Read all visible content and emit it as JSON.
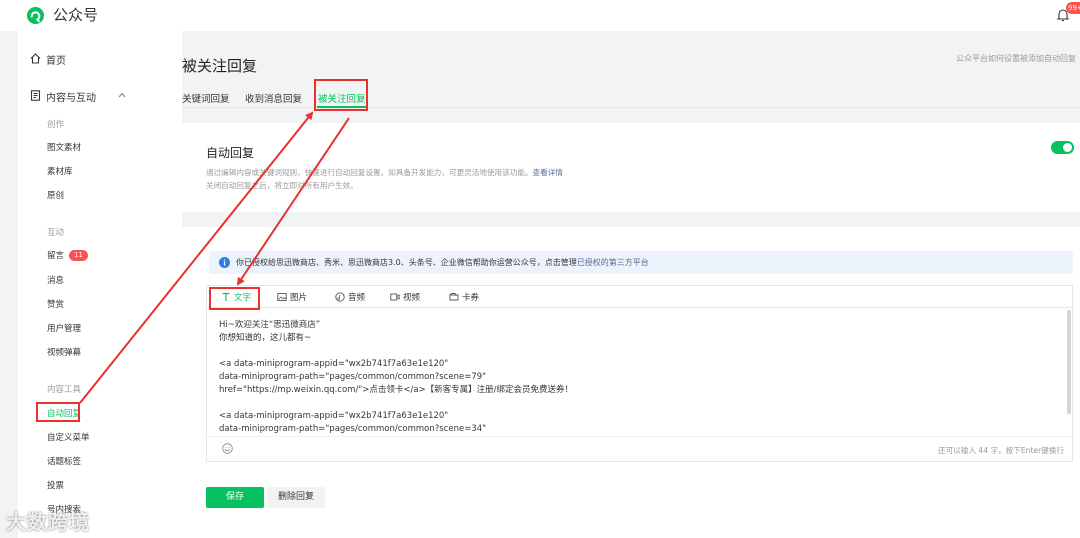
{
  "app": {
    "brand": "公众号",
    "notifications": "99+"
  },
  "sidebar": {
    "home": "首页",
    "content": "内容与互动",
    "groups": [
      {
        "title": "创作",
        "items": [
          "图文素材",
          "素材库",
          "原创"
        ]
      },
      {
        "title": "互动",
        "items": [
          "留言",
          "消息",
          "赞赏",
          "用户管理",
          "视频弹幕"
        ]
      },
      {
        "title": "内容工具",
        "items": [
          "自动回复",
          "自定义菜单",
          "话题标签",
          "投票",
          "号内搜索"
        ]
      }
    ],
    "comment_badge": "11"
  },
  "page": {
    "title": "被关注回复",
    "help": "公众平台如何设置被添加自动回复",
    "tabs": [
      "关键词回复",
      "收到消息回复",
      "被关注回复"
    ]
  },
  "auto_reply": {
    "title": "自动回复",
    "desc1": "通过编辑内容或关键词规则，快速进行自动回复设置。如具备开发能力，可更灵活地使用该功能。",
    "desc_link": "查看详情",
    "desc2": "关闭自动回复之后，将立即对所有用户生效。",
    "enabled": true
  },
  "notice": {
    "text": "你已授权给思迅微商店、秀米、思迅微商店3.0、头条号、企业微信帮助你运营公众号，点击管理",
    "link": "已授权的第三方平台"
  },
  "editor": {
    "tabs": [
      "文字",
      "图片",
      "音频",
      "视频",
      "卡券"
    ],
    "lines": [
      "Hi~欢迎关注“思迅微商店”",
      "你想知道的，这儿都有~",
      "",
      "<a data-miniprogram-appid=\"wx2b741f7a63e1e120\"",
      "data-miniprogram-path=\"pages/common/common?scene=79\"",
      "href=\"https://mp.weixin.qq.com/\">点击领卡</a>【新客专属】注册/绑定会员免费送券！",
      "",
      "<a data-miniprogram-appid=\"wx2b741f7a63e1e120\"",
      "data-miniprogram-path=\"pages/common/common?scene=34\""
    ],
    "counter": "还可以输入 44 字，按下Enter键换行"
  },
  "actions": {
    "save": "保存",
    "delete": "删除回复"
  },
  "watermark": "大数跨境",
  "colors": {
    "accent": "#07c160",
    "annotation": "#e8322e",
    "link": "#576b95"
  }
}
